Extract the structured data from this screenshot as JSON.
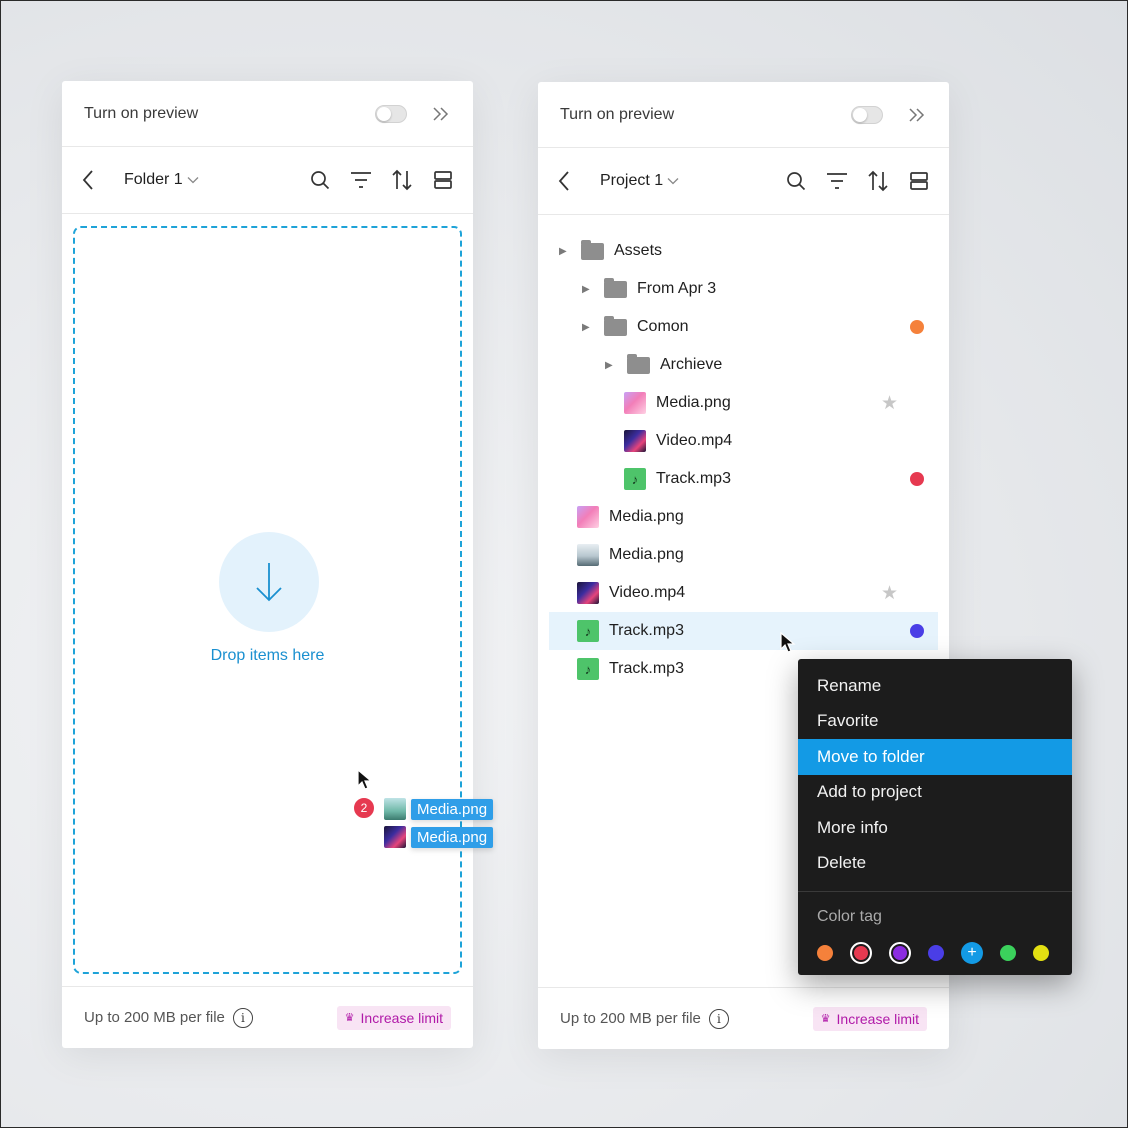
{
  "left_panel": {
    "preview_label": "Turn on preview",
    "breadcrumb": "Folder 1",
    "drop_text": "Drop items here",
    "footer_text": "Up to 200 MB per file",
    "limit_label": "Increase limit",
    "drag": {
      "count": "2",
      "items": [
        "Media.png",
        "Media.png"
      ]
    }
  },
  "right_panel": {
    "preview_label": "Turn on preview",
    "breadcrumb": "Project 1",
    "footer_text": "Up to 200 MB per file",
    "limit_label": "Increase limit",
    "tree": [
      {
        "label": "Assets",
        "kind": "folder",
        "expandable": true
      },
      {
        "label": "From Apr 3",
        "kind": "folder",
        "expandable": true
      },
      {
        "label": "Comon",
        "kind": "folder",
        "expandable": true,
        "tag": "#f5813b"
      },
      {
        "label": "Archieve",
        "kind": "folder",
        "expandable": true
      },
      {
        "label": "Media.png",
        "kind": "image-pink",
        "favorite": true
      },
      {
        "label": "Video.mp4",
        "kind": "video"
      },
      {
        "label": "Track.mp3",
        "kind": "audio",
        "tag": "#e63950"
      },
      {
        "label": "Media.png",
        "kind": "image-pink"
      },
      {
        "label": "Media.png",
        "kind": "image-photo"
      },
      {
        "label": "Video.mp4",
        "kind": "video",
        "favorite": true
      },
      {
        "label": "Track.mp3",
        "kind": "audio",
        "tag": "#4a3ee6",
        "selected": true
      },
      {
        "label": "Track.mp3",
        "kind": "audio"
      }
    ]
  },
  "context_menu": {
    "items": [
      "Rename",
      "Favorite",
      "Move to folder",
      "Add to project",
      "More info",
      "Delete"
    ],
    "active": "Move to folder",
    "color_tag_label": "Color tag",
    "swatches": [
      "#f5813b",
      "#e63950",
      "#8b2be0",
      "#4a3ee6",
      "#139ae5",
      "#3bd15c",
      "#e3e012"
    ]
  },
  "colors": {
    "accent": "#139ae5",
    "drop_border": "#1ea3d8",
    "limit_text": "#b01aa8"
  }
}
